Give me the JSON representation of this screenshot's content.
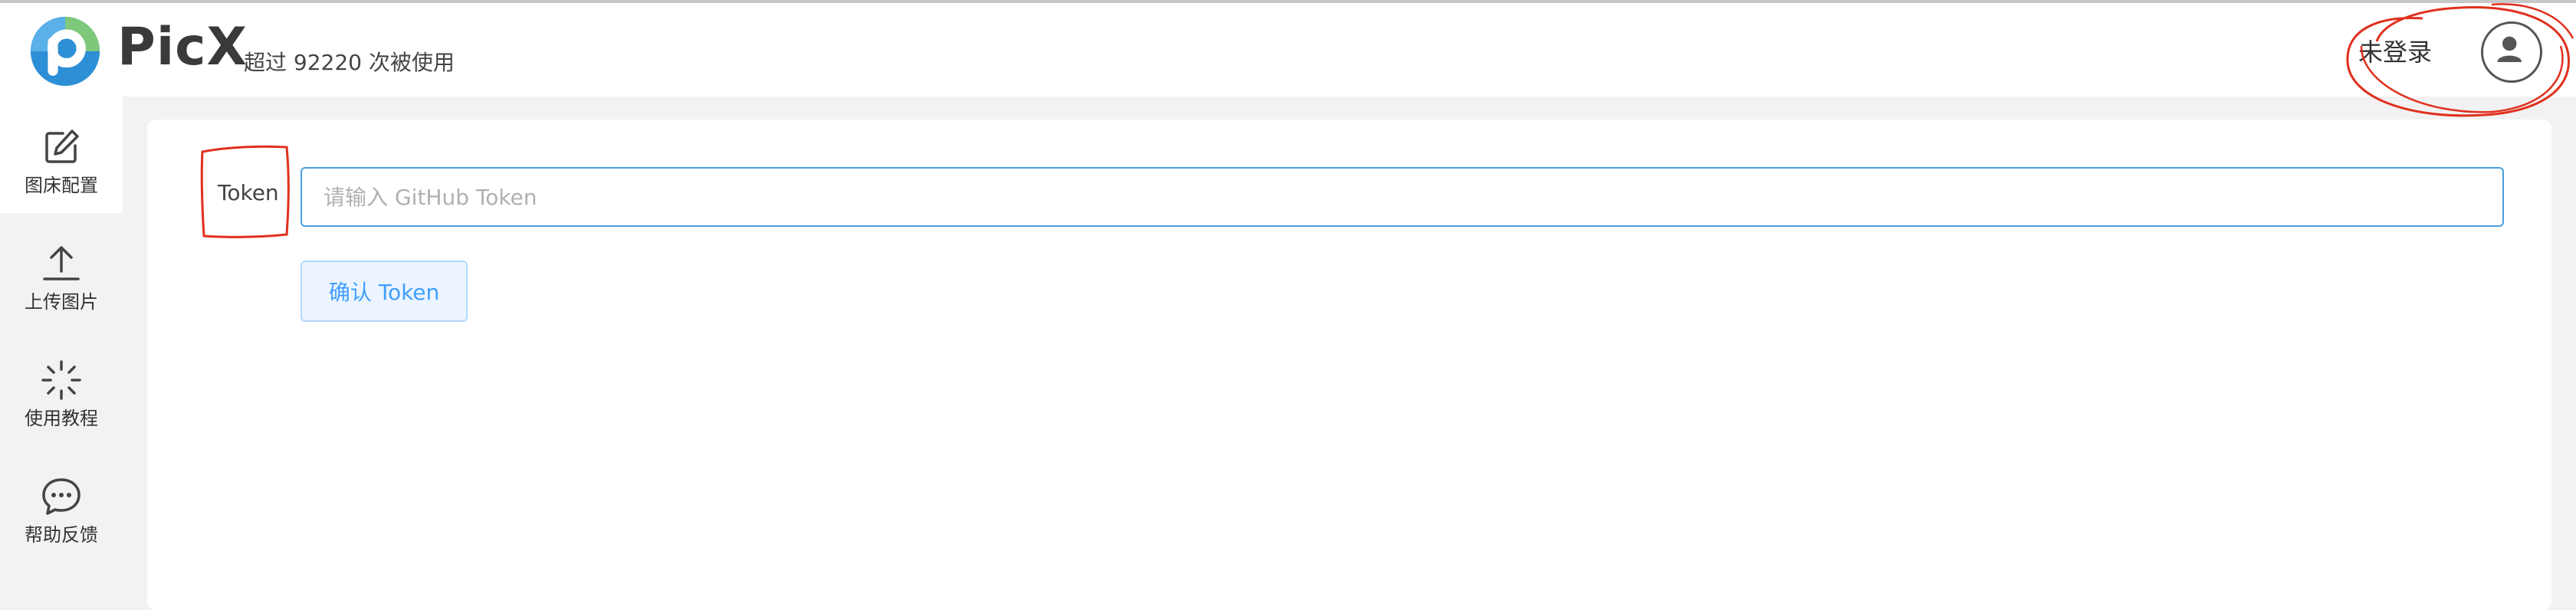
{
  "header": {
    "brand": "PicX",
    "usage_text": "超过 92220 次被使用",
    "login_status": "未登录"
  },
  "sidebar": {
    "items": [
      {
        "label": "图床配置",
        "icon": "edit-icon",
        "active": true
      },
      {
        "label": "上传图片",
        "icon": "upload-icon",
        "active": false
      },
      {
        "label": "使用教程",
        "icon": "spinner-icon",
        "active": false
      },
      {
        "label": "帮助反馈",
        "icon": "chat-bubble-icon",
        "active": false
      }
    ]
  },
  "main": {
    "token_label": "Token",
    "token_input": {
      "value": "",
      "placeholder": "请输入 GitHub Token"
    },
    "confirm_button": "确认 Token"
  },
  "colors": {
    "accent": "#409eff",
    "input_border": "#4a9fe0",
    "annotation": "#e0301e",
    "logo_blue": "#2d8fd5",
    "logo_green": "#7ec87c"
  }
}
